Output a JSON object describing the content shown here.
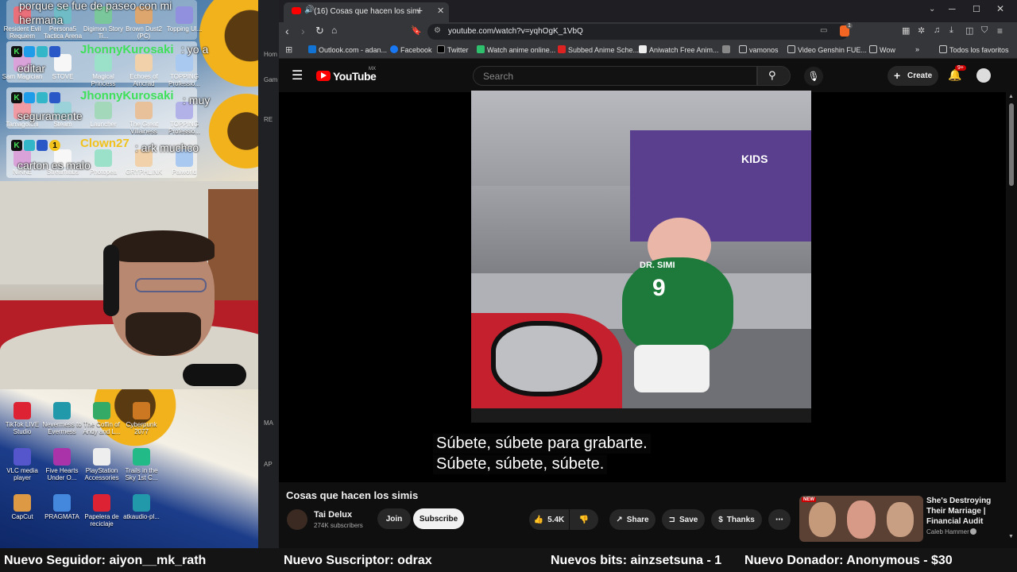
{
  "chat": [
    {
      "user": "",
      "message": "porque se fue de paseo con mi hermana"
    },
    {
      "user": "JhonnyKurosaki",
      "message": ": yo a editar",
      "color": "#3fe05a"
    },
    {
      "user": "JhonnyKurosaki",
      "message": ": muy seguramente",
      "color": "#3fe05a"
    },
    {
      "user": "Clown27",
      "message": ": ark muchco carton es malo",
      "color": "#f2c21c"
    }
  ],
  "desktop_top_icons": [
    "Resident Evil Requiem",
    "Persona5 Tactica Arena",
    "Digimon Story Ti...",
    "Brown Dust2 (PC)",
    "Topping Ul...",
    "Sam Magician",
    "STOVE",
    "Magical Princess",
    "Echoes of Aincrad",
    "TOPPING Professio...",
    "Tamagotchi",
    "Steam",
    "Launcher",
    "The Great Villainess",
    "TOPPING Professio...",
    "NIKKE",
    "Streamlabs",
    "Photopea",
    "GRYPHLINK",
    "Palworld"
  ],
  "desktop_bottom_icons": [
    "TikTok LIVE Studio",
    "Nevermess to Evermess",
    "The Coffin of Andy and L...",
    "Cyberpunk 2077",
    "VLC media player",
    "Five Hearts Under O...",
    "PlayStation Accessories",
    "Trails in the Sky 1st C...",
    "CapCut",
    "PRAGMATA",
    "Papelera de reciclaje",
    "atkaudio-pl..."
  ],
  "ticker": [
    "Nuevo Seguidor: aiyon__mk_rath",
    "Nuevo Suscriptor: odrax",
    "Nuevos bits: ainzsetsuna - 1",
    "Nuevo Donador: Anonymous - $30"
  ],
  "browser": {
    "tab_title": "(16) Cosas que hacen los simi",
    "url": "youtube.com/watch?v=yqhOgK_1VbQ",
    "ext_badge": "1",
    "bookmarks": [
      "Outlook.com - adan...",
      "Facebook",
      "Twitter",
      "Watch anime online...",
      "Subbed Anime Sche...",
      "Aniwatch Free Anim...",
      "",
      "vamonos",
      "Video Genshin FUE...",
      "Wow"
    ],
    "all_favorites": "Todos los favoritos",
    "sidebar_labels": [
      "Hom",
      "Gam",
      "RE",
      "MA",
      "AP"
    ]
  },
  "youtube": {
    "logo": "YouTube",
    "country": "MX",
    "search_placeholder": "Search",
    "create": "Create",
    "notifications": "9+",
    "subtitle_1": "Súbete, súbete para grabarte.",
    "subtitle_2": "Súbete, súbete, súbete.",
    "video_jersey_name": "DR. SIMI",
    "video_jersey_number": "9",
    "video_store_sign": "KIDS",
    "title": "Cosas que hacen los simis",
    "channel": "Tai Delux",
    "subscribers": "274K subscribers",
    "join": "Join",
    "subscribe": "Subscribe",
    "likes": "5.4K",
    "share": "Share",
    "save": "Save",
    "thanks": "Thanks",
    "rec": {
      "badge": "NEW",
      "title": "She's Destroying Their Marriage | Financial Audit",
      "channel": "Caleb Hammer"
    }
  }
}
